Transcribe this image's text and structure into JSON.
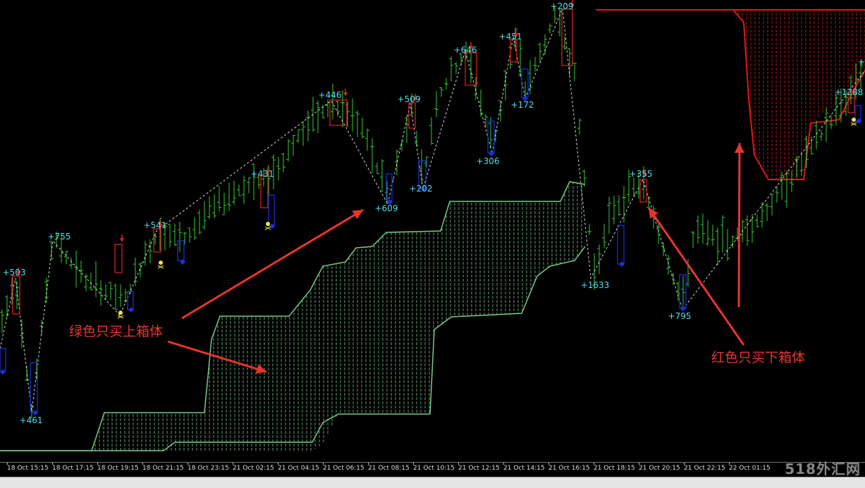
{
  "time_axis": {
    "labels": [
      "18 Oct 15:15",
      "18 Oct 17:15",
      "18 Oct 19:15",
      "18 Oct 21:15",
      "18 Oct 23:15",
      "21 Oct 02:15",
      "21 Oct 04:15",
      "21 Oct 06:15",
      "21 Oct 08:15",
      "21 Oct 10:15",
      "21 Oct 12:15",
      "21 Oct 14:15",
      "21 Oct 16:15",
      "21 Oct 18:15",
      "21 Oct 20:15",
      "21 Oct 22:15",
      "22 Oct 01:15"
    ]
  },
  "zigzag_labels": [
    "+503",
    "+461",
    "+755",
    "+541",
    "+431",
    "+446",
    "+609",
    "+509",
    "+202",
    "+646",
    "+306",
    "+451",
    "+172",
    "+209",
    "+1633",
    "+355",
    "+795",
    "+1288",
    "+"
  ],
  "annotations": {
    "green_text": "绿色只买上箱体",
    "red_text": "红色只买下箱体"
  },
  "watermark": "518外汇网",
  "colors": {
    "background": "#000000",
    "candle_green": "#33cc33",
    "cloud_green": "#79c98c",
    "cloud_red": "#e01818",
    "zigzag_label": "#55ddee",
    "arrow_red": "#e8352c",
    "box_blue": "#1a2fd8",
    "box_red": "#d82020"
  }
}
